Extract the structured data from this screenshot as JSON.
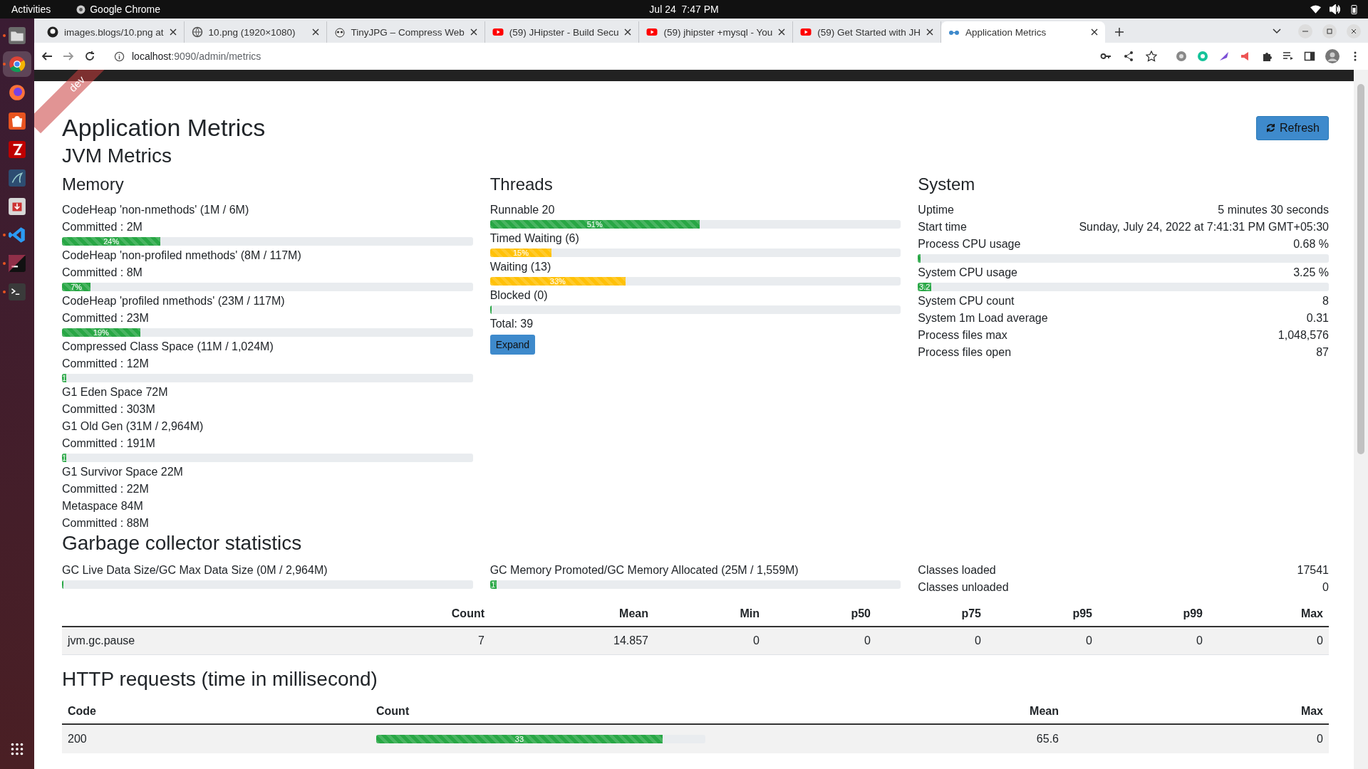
{
  "topbar": {
    "activities": "Activities",
    "app": "Google Chrome",
    "clock": "Jul 24  7:47 PM"
  },
  "dock": [
    {
      "kind": "folder",
      "running": true,
      "selected": false
    },
    {
      "kind": "chrome",
      "running": true,
      "selected": true
    },
    {
      "kind": "firefox",
      "running": false,
      "selected": false
    },
    {
      "kind": "store",
      "running": false,
      "selected": false
    },
    {
      "kind": "filezilla",
      "running": false,
      "selected": false
    },
    {
      "kind": "workbench",
      "running": false,
      "selected": false
    },
    {
      "kind": "installer",
      "running": false,
      "selected": false
    },
    {
      "kind": "vscode",
      "running": true,
      "selected": false
    },
    {
      "kind": "intellij",
      "running": true,
      "selected": false
    },
    {
      "kind": "terminal",
      "running": true,
      "selected": false
    },
    {
      "kind": "grid",
      "running": false,
      "selected": false
    }
  ],
  "browser": {
    "tabs": [
      {
        "title": "images.blogs/10.png at",
        "kind": "github",
        "selected": false
      },
      {
        "title": "10.png (1920×1080)",
        "kind": "globe",
        "selected": false
      },
      {
        "title": "TinyJPG – Compress Web",
        "kind": "panda",
        "selected": false
      },
      {
        "title": "(59) JHipster - Build Secu",
        "kind": "youtube",
        "selected": false
      },
      {
        "title": "(59) jhipster +mysql - You",
        "kind": "youtube",
        "selected": false
      },
      {
        "title": "(59) Get Started with JH",
        "kind": "youtube",
        "selected": false
      },
      {
        "title": "Application Metrics",
        "kind": "glasses",
        "selected": true
      }
    ],
    "url_host": "localhost",
    "url_path": ":9090/admin/metrics"
  },
  "page": {
    "ribbon": "dev",
    "title": "Application Metrics",
    "refresh": "Refresh",
    "subtitle": "JVM Metrics",
    "memory": {
      "title": "Memory",
      "items": [
        {
          "name": "CodeHeap 'non-nmethods' (1M / 6M)",
          "committed": "Committed : 2M",
          "level": 0.24,
          "label": "24%"
        },
        {
          "name": "CodeHeap 'non-profiled nmethods' (8M / 117M)",
          "committed": "Committed : 8M",
          "level": 0.07,
          "label": "7%"
        },
        {
          "name": "CodeHeap 'profiled nmethods' (23M / 117M)",
          "committed": "Committed : 23M",
          "level": 0.19,
          "label": "19%"
        },
        {
          "name": "Compressed Class Space (11M / 1,024M)",
          "committed": "Committed : 12M",
          "level": 0.01,
          "label": "1"
        },
        {
          "name": "G1 Eden Space 72M",
          "committed": "Committed : 303M"
        },
        {
          "name": "G1 Old Gen (31M / 2,964M)",
          "committed": "Committed : 191M",
          "level": 0.01,
          "label": "1"
        },
        {
          "name": "G1 Survivor Space 22M",
          "committed": "Committed : 22M"
        },
        {
          "name": "Metaspace 84M",
          "committed": "Committed : 88M"
        }
      ]
    },
    "threads": {
      "title": "Threads",
      "items": [
        {
          "name": "Runnable 20",
          "level": 0.51,
          "label": "51%",
          "color": "#28a745"
        },
        {
          "name": "Timed Waiting (6)",
          "level": 0.15,
          "label": "15%",
          "color": "#ffc107"
        },
        {
          "name": "Waiting (13)",
          "level": 0.33,
          "label": "33%",
          "color": "#ffc107"
        },
        {
          "name": "Blocked (0)",
          "level": 0
        }
      ],
      "total": "Total: 39",
      "expand": "Expand"
    },
    "system": {
      "title": "System",
      "rows": [
        {
          "label": "Uptime",
          "value": "5 minutes 30 seconds"
        },
        {
          "label": "Start time",
          "value": "Sunday, July 24, 2022 at 7:41:31 PM GMT+05:30"
        },
        {
          "label": "Process CPU usage",
          "value": "0.68 %",
          "level": 0.0068
        },
        {
          "label": "System CPU usage",
          "value": "3.25 %",
          "level": 0.0325,
          "bar_label": "3.2"
        },
        {
          "label": "System CPU count",
          "value": "8"
        },
        {
          "label": "System 1m Load average",
          "value": "0.31"
        },
        {
          "label": "Process files max",
          "value": "1,048,576"
        },
        {
          "label": "Process files open",
          "value": "87"
        }
      ]
    },
    "gc": {
      "title": "Garbage collector statistics",
      "bars": [
        {
          "name": "GC Live Data Size/GC Max Data Size (0M / 2,964M)",
          "level": 0
        },
        {
          "name": "GC Memory Promoted/GC Memory Allocated (25M / 1,559M)",
          "level": 0.016,
          "label": "1"
        }
      ],
      "classes": [
        {
          "label": "Classes loaded",
          "value": "17541"
        },
        {
          "label": "Classes unloaded",
          "value": "0"
        }
      ],
      "columns": [
        "",
        "Count",
        "Mean",
        "Min",
        "p50",
        "p75",
        "p95",
        "p99",
        "Max"
      ],
      "rows": [
        [
          "jvm.gc.pause",
          "7",
          "14.857",
          "0",
          "0",
          "0",
          "0",
          "0",
          "0"
        ]
      ]
    },
    "http": {
      "title": "HTTP requests (time in millisecond)",
      "columns": [
        "Code",
        "Count",
        "Mean",
        "Max"
      ],
      "rows": [
        {
          "code": "200",
          "level": 0.87,
          "count": "33",
          "mean": "65.6",
          "max": "0"
        }
      ]
    }
  }
}
